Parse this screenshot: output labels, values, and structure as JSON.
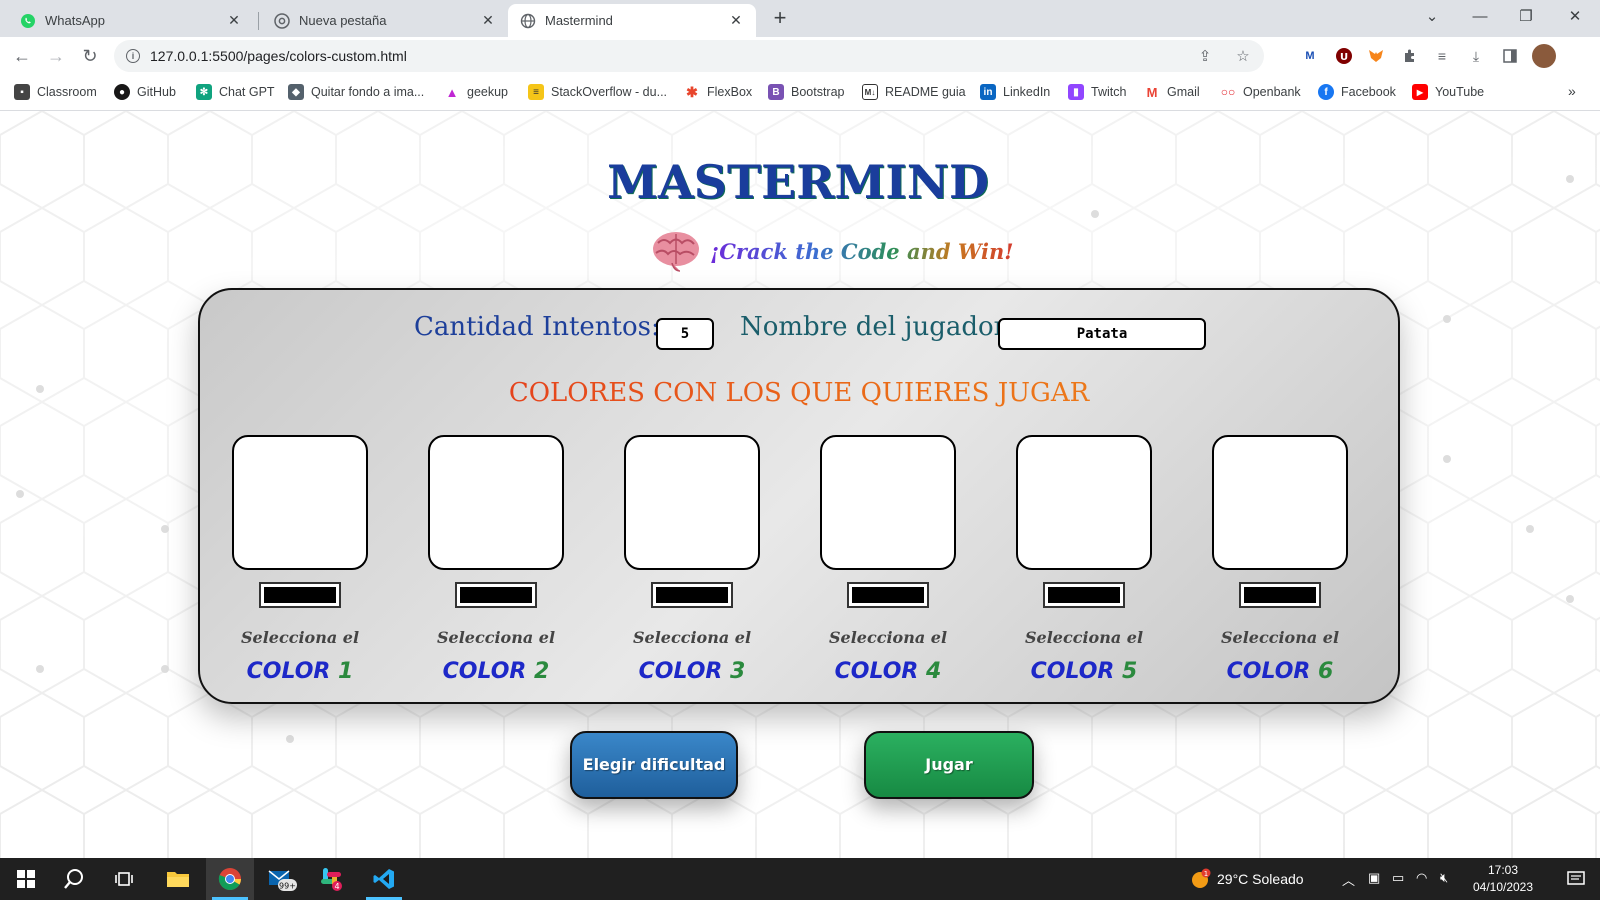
{
  "browser": {
    "tabs": [
      {
        "title": "WhatsApp",
        "icon": "whatsapp-icon",
        "active": false
      },
      {
        "title": "Nueva pestaña",
        "icon": "chrome-icon",
        "active": false
      },
      {
        "title": "Mastermind",
        "icon": "globe-icon",
        "active": true
      }
    ],
    "url": "127.0.0.1:5500/pages/colors-custom.html",
    "bookmarks": [
      {
        "label": "Classroom",
        "icon": "classroom-icon",
        "color": "#444444"
      },
      {
        "label": "GitHub",
        "icon": "github-icon",
        "color": "#181717"
      },
      {
        "label": "Chat GPT",
        "icon": "chatgpt-icon",
        "color": "#10a37f"
      },
      {
        "label": "Quitar fondo a ima...",
        "icon": "removebg-icon",
        "color": "#54616c"
      },
      {
        "label": "geekup",
        "icon": "geekup-icon",
        "color": "#c026d3"
      },
      {
        "label": "StackOverflow - du...",
        "icon": "stackoverflow-icon",
        "color": "#f48024"
      },
      {
        "label": "FlexBox",
        "icon": "flexbox-icon",
        "color": "#e8452c"
      },
      {
        "label": "Bootstrap",
        "icon": "bootstrap-icon",
        "color": "#7952b3"
      },
      {
        "label": "README guia",
        "icon": "markdown-icon",
        "color": "#333333"
      },
      {
        "label": "LinkedIn",
        "icon": "linkedin-icon",
        "color": "#0a66c2"
      },
      {
        "label": "Twitch",
        "icon": "twitch-icon",
        "color": "#9146ff"
      },
      {
        "label": "Gmail",
        "icon": "gmail-icon",
        "color": "#ea4335"
      },
      {
        "label": "Openbank",
        "icon": "openbank-icon",
        "color": "#e3262e"
      },
      {
        "label": "Facebook",
        "icon": "facebook-icon",
        "color": "#1877f2"
      },
      {
        "label": "YouTube",
        "icon": "youtube-icon",
        "color": "#ff0000"
      }
    ],
    "bookmarks_more": "»"
  },
  "app": {
    "title": "MASTERMIND",
    "subtitle": "¡Crack the Code and Win!",
    "attempts_label": "Cantidad Intentos:",
    "attempts_value": "5",
    "player_label": "Nombre del jugador:",
    "player_value": "Patata",
    "colors_heading": "COLORES CON LOS QUE QUIERES JUGAR",
    "slots": [
      {
        "select_label": "Selecciona el",
        "color_word": "COLOR",
        "number": "1",
        "value": "#000000"
      },
      {
        "select_label": "Selecciona el",
        "color_word": "COLOR",
        "number": "2",
        "value": "#000000"
      },
      {
        "select_label": "Selecciona el",
        "color_word": "COLOR",
        "number": "3",
        "value": "#000000"
      },
      {
        "select_label": "Selecciona el",
        "color_word": "COLOR",
        "number": "4",
        "value": "#000000"
      },
      {
        "select_label": "Selecciona el",
        "color_word": "COLOR",
        "number": "5",
        "value": "#000000"
      },
      {
        "select_label": "Selecciona el",
        "color_word": "COLOR",
        "number": "6",
        "value": "#000000"
      }
    ],
    "buttons": {
      "difficulty": "Elegir dificultad",
      "play": "Jugar"
    }
  },
  "taskbar": {
    "weather": "29°C  Soleado",
    "weather_badge": "1",
    "mail_badge": "99+",
    "slack_badge": "4",
    "time": "17:03",
    "date": "04/10/2023"
  },
  "colors": {
    "title_blue": "#1a3d9c",
    "heading_red": "#e02020",
    "button_blue": "#2a72b5",
    "button_green": "#1f9d50"
  }
}
